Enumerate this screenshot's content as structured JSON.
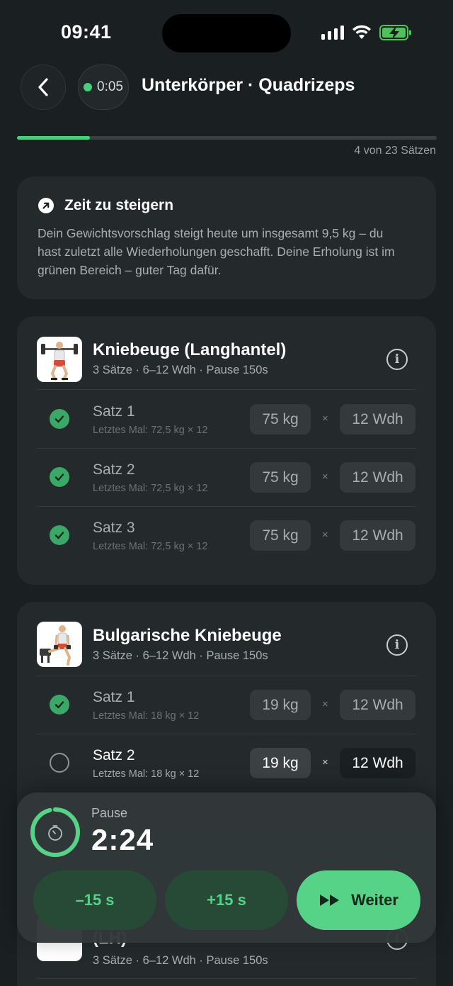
{
  "status": {
    "time": "09:41"
  },
  "header": {
    "elapsed": "0:05",
    "title": "Unterkörper · Quadrizeps"
  },
  "progress": {
    "label": "4 von 23 Sätzen",
    "completed": 4,
    "total": 23,
    "color": "#48d07f"
  },
  "info_card": {
    "title": "Zeit zu steigern",
    "text": "Dein Gewichtsvorschlag steigt heute um insgesamt 9,5 kg – du hast zuletzt alle Wiederholungen geschafft. Deine Erholung ist im grünen Bereich – guter Tag dafür.",
    "icon": "arrow-up-right-icon"
  },
  "exercises": [
    {
      "name": "Kniebeuge (Langhantel)",
      "meta": "3 Sätze · 6–12 Wdh · Pause 150s",
      "sets": [
        {
          "label": "Satz 1",
          "last": "Letztes Mal: 72,5 kg × 12",
          "weight": "75 kg",
          "reps": "12 Wdh",
          "done": true
        },
        {
          "label": "Satz 2",
          "last": "Letztes Mal: 72,5 kg × 12",
          "weight": "75 kg",
          "reps": "12 Wdh",
          "done": true
        },
        {
          "label": "Satz 3",
          "last": "Letztes Mal: 72,5 kg × 12",
          "weight": "75 kg",
          "reps": "12 Wdh",
          "done": true
        }
      ]
    },
    {
      "name": "Bulgarische Kniebeuge",
      "meta": "3 Sätze · 6–12 Wdh · Pause 150s",
      "sets": [
        {
          "label": "Satz 1",
          "last": "Letztes Mal: 18 kg × 12",
          "weight": "19 kg",
          "reps": "12 Wdh",
          "done": true
        },
        {
          "label": "Satz 2",
          "last": "Letztes Mal: 18 kg × 12",
          "weight": "19 kg",
          "reps": "12 Wdh",
          "done": false
        }
      ]
    },
    {
      "name": "(LH)",
      "meta": "3 Sätze · 6–12 Wdh · Pause 150s"
    }
  ],
  "set_separator": "×",
  "rest": {
    "label": "Pause",
    "time": "2:24",
    "ring_fraction": 0.96,
    "minus_label": "–15 s",
    "plus_label": "+15 s",
    "next_label": "Weiter"
  }
}
